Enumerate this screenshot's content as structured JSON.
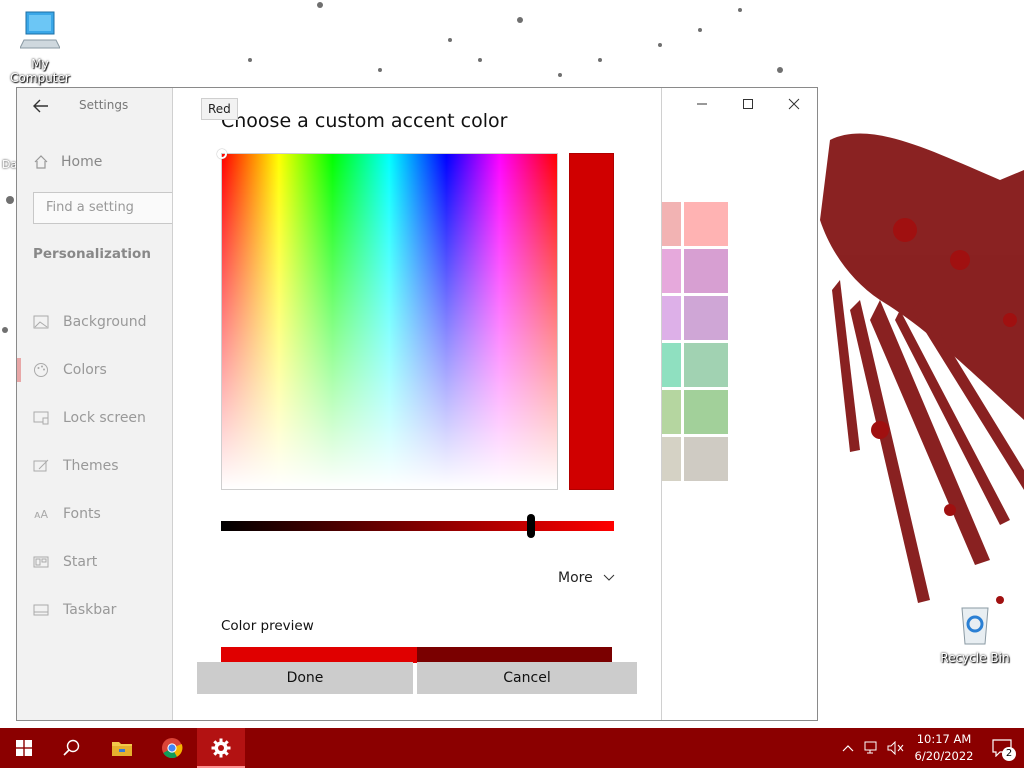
{
  "desktop": {
    "icons": [
      {
        "label": "My Computer",
        "icon": "computer-icon"
      },
      {
        "label": "Recycle Bin",
        "icon": "recycle-bin-icon"
      }
    ],
    "hidden_label_fragment": "Da"
  },
  "settings": {
    "title": "Settings",
    "home_label": "Home",
    "search_placeholder": "Find a setting",
    "section": "Personalization",
    "nav": [
      {
        "label": "Background",
        "icon": "image-icon"
      },
      {
        "label": "Colors",
        "icon": "palette-icon",
        "active": true
      },
      {
        "label": "Lock screen",
        "icon": "lock-screen-icon"
      },
      {
        "label": "Themes",
        "icon": "themes-icon"
      },
      {
        "label": "Fonts",
        "icon": "fonts-icon"
      },
      {
        "label": "Start",
        "icon": "start-icon"
      },
      {
        "label": "Taskbar",
        "icon": "taskbar-icon"
      }
    ],
    "swatches": [
      "#f2b3b3",
      "#ffb3b3",
      "#e6a9dc",
      "#d79fd2",
      "#ddb0e8",
      "#cfa6d6",
      "#8fe0c0",
      "#a1d2b2",
      "#b5d6a0",
      "#a2d09a",
      "#d5d2c5",
      "#cfcbc3"
    ]
  },
  "dialog": {
    "tooltip": "Red",
    "title": "Choose a custom accent color",
    "selected_color": "#d00000",
    "brightness_fraction": 0.79,
    "more_label": "More",
    "preview_label": "Color preview",
    "preview_colors": [
      "#e00000",
      "#7a0000"
    ],
    "done_label": "Done",
    "cancel_label": "Cancel"
  },
  "taskbar": {
    "color": "#8b0000",
    "apps": [
      {
        "name": "start-icon"
      },
      {
        "name": "search-icon"
      },
      {
        "name": "file-explorer-icon"
      },
      {
        "name": "chrome-icon"
      },
      {
        "name": "settings-gear-icon",
        "active": true
      }
    ],
    "clock": {
      "time": "10:17 AM",
      "date": "6/20/2022"
    },
    "notification_count": "2"
  }
}
